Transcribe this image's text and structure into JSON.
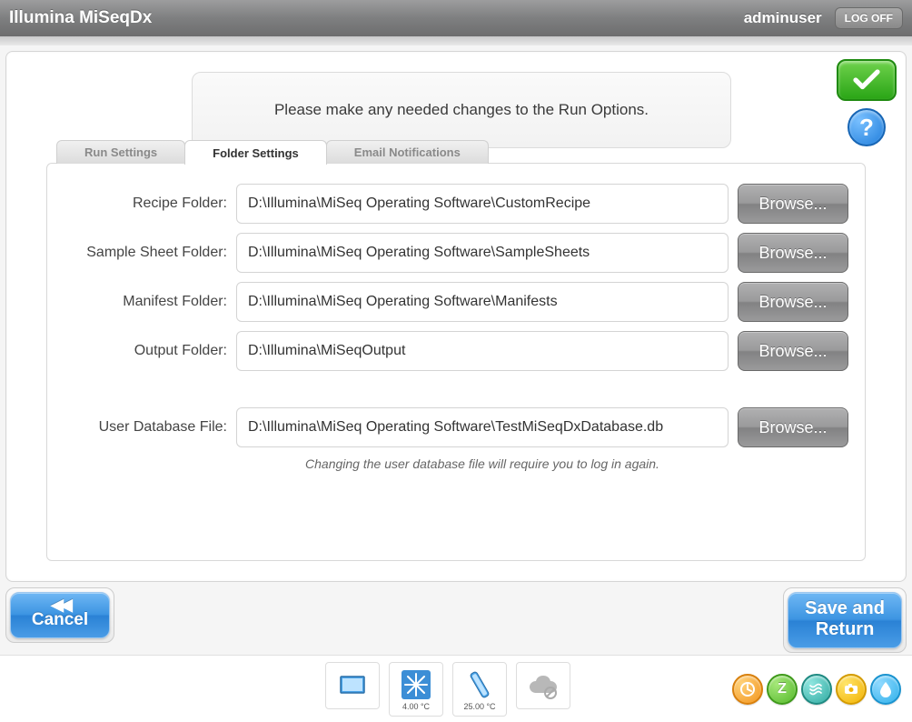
{
  "titlebar": {
    "app_title": "Illumina MiSeqDx",
    "username": "adminuser",
    "logoff_label": "LOG OFF"
  },
  "instruction": "Please make any needed changes to the Run Options.",
  "help_glyph": "?",
  "tabs": {
    "run_settings": "Run Settings",
    "folder_settings": "Folder Settings",
    "email_notifications": "Email Notifications",
    "active": "folder_settings"
  },
  "form": {
    "recipe": {
      "label": "Recipe Folder:",
      "value": "D:\\Illumina\\MiSeq Operating Software\\CustomRecipe",
      "browse": "Browse..."
    },
    "samplesheet": {
      "label": "Sample Sheet Folder:",
      "value": "D:\\Illumina\\MiSeq Operating Software\\SampleSheets",
      "browse": "Browse..."
    },
    "manifest": {
      "label": "Manifest Folder:",
      "value": "D:\\Illumina\\MiSeq Operating Software\\Manifests",
      "browse": "Browse..."
    },
    "output": {
      "label": "Output Folder:",
      "value": "D:\\Illumina\\MiSeqOutput",
      "browse": "Browse..."
    },
    "userdb": {
      "label": "User Database File:",
      "value": "D:\\Illumina\\MiSeq Operating Software\\TestMiSeqDxDatabase.db",
      "browse": "Browse...",
      "note": "Changing the user database file will require you to log in again."
    }
  },
  "buttons": {
    "cancel": "Cancel",
    "save_line1": "Save and",
    "save_line2": "Return"
  },
  "status": {
    "chiller_temp": "4.00 °C",
    "flowcell_temp": "25.00 °C"
  },
  "circle_icons": {
    "clock": "clock-icon",
    "z": "z-icon",
    "wave": "wave-icon",
    "camera": "camera-icon",
    "drop": "drop-icon"
  }
}
